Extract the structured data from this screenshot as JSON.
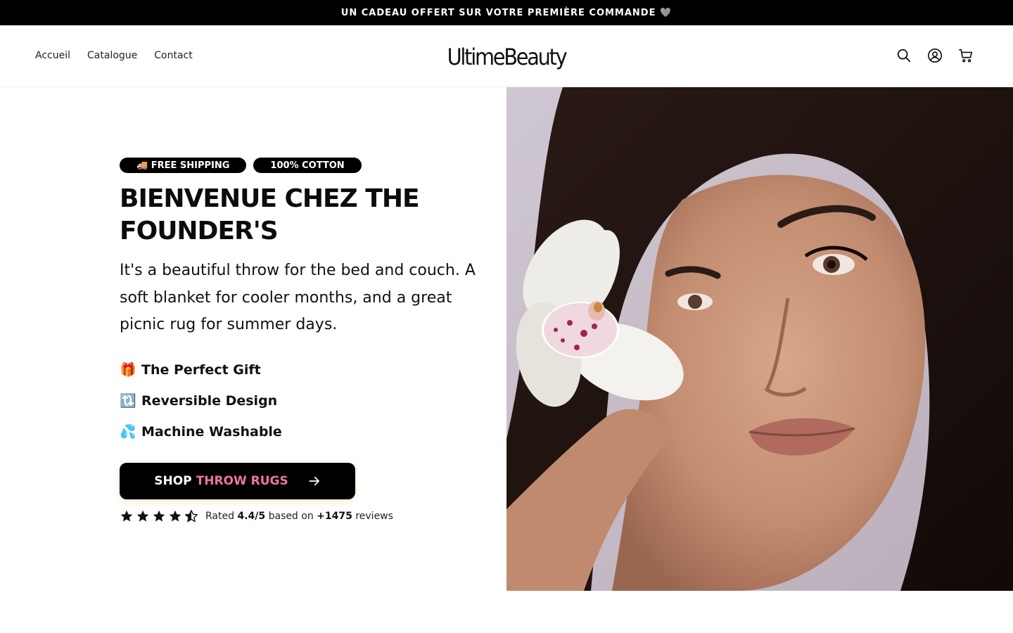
{
  "announcement": "UN CADEAU OFFERT SUR VOTRE PREMIÈRE COMMANDE 🩶",
  "nav": [
    {
      "label": "Accueil"
    },
    {
      "label": "Catalogue"
    },
    {
      "label": "Contact"
    }
  ],
  "logo": "UltimeBeauty",
  "header_icons": [
    "search-icon",
    "account-icon",
    "cart-icon"
  ],
  "hero": {
    "badges": [
      "🚚 FREE SHIPPING",
      "100% COTTON"
    ],
    "title": "BIENVENUE CHEZ THE FOUNDER'S",
    "description": "It's a beautiful throw for the bed and couch. A soft blanket for cooler months, and a great picnic rug for summer days.",
    "features": [
      {
        "emoji": "🎁",
        "label": "The Perfect Gift"
      },
      {
        "emoji": "🔃",
        "label": "Reversible Design"
      },
      {
        "emoji": "💦",
        "label": "Machine Washable"
      }
    ],
    "cta": {
      "prefix": "SHOP",
      "accent": "THROW RUGS",
      "icon": "arrow-right-icon"
    },
    "rating": {
      "stars": 4.5,
      "prefix": "Rated",
      "score": "4.4/5",
      "middle": "based on",
      "count": "+1475",
      "suffix": "reviews"
    },
    "image_alt": "Woman holding a white orchid flower near her face"
  },
  "colors": {
    "announcement_bg": "#000000",
    "cta_bg": "#000000",
    "cta_accent": "#ee74a6",
    "badge_bg": "#000000"
  }
}
